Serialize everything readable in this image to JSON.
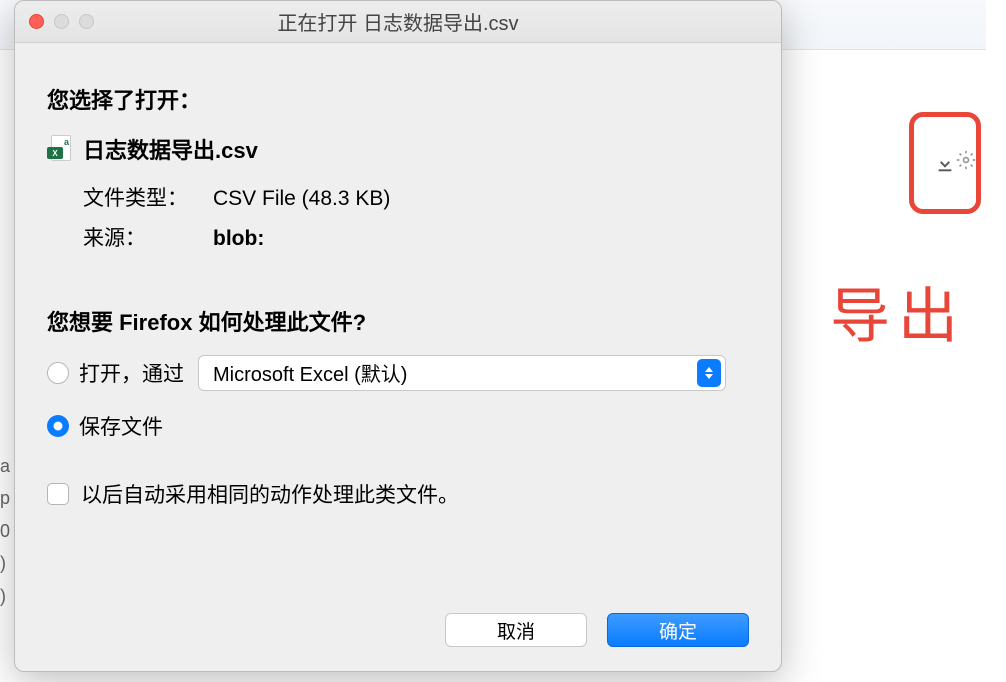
{
  "dialog": {
    "title": "正在打开 日志数据导出.csv",
    "prompt_heading": "您选择了打开：",
    "file_name": "日志数据导出.csv",
    "file_type_label": "文件类型：",
    "file_type_value": "CSV File (48.3 KB)",
    "source_label": "来源：",
    "source_value": "blob:",
    "action_heading": "您想要 Firefox 如何处理此文件?",
    "open_with_label": "打开，通过",
    "open_with_selected": "Microsoft Excel (默认)",
    "save_file_label": "保存文件",
    "always_checkbox_label": "以后自动采用相同的动作处理此类文件。",
    "cancel_button": "取消",
    "confirm_button": "确定"
  },
  "background": {
    "export_label": "导出",
    "partial_text": "a\np\n0\n)\n)"
  }
}
